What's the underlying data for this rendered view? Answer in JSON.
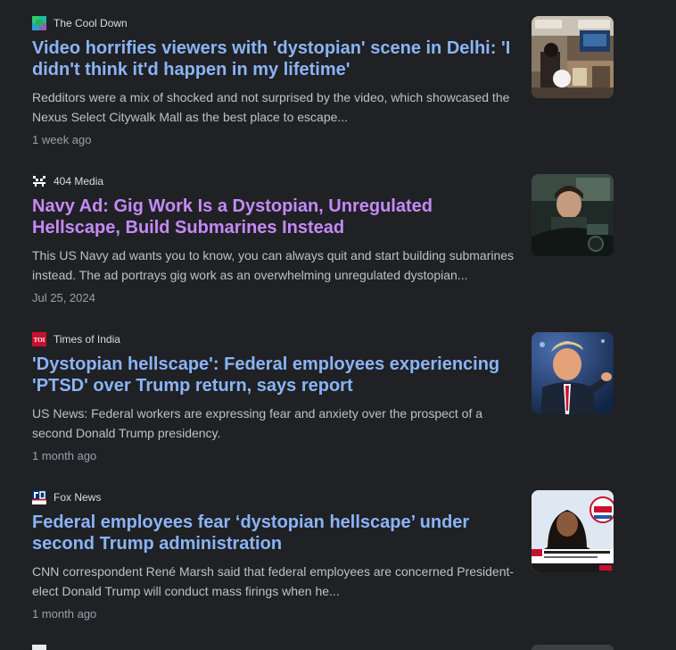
{
  "articles": [
    {
      "source": "The Cool Down",
      "title": "Video horrifies viewers with 'dystopian' scene in Delhi: 'I didn't think it'd happen in my lifetime'",
      "snippet": "Redditors were a mix of shocked and not surprised by the video, which showcased the Nexus Select Citywalk Mall as the best place to escape...",
      "time": "1 week ago",
      "visited": false,
      "favicon_icon": "the-cool-down-logo-icon",
      "thumb_icon": "mall-interior-photo"
    },
    {
      "source": "404 Media",
      "title": "Navy Ad: Gig Work Is a Dystopian, Unregulated Hellscape, Build Submarines Instead",
      "snippet": "This US Navy ad wants you to know, you can always quit and start building submarines instead. The ad portrays gig work as an overwhelming unregulated dystopian...",
      "time": "Jul 25, 2024",
      "visited": true,
      "favicon_icon": "404-media-logo-icon",
      "thumb_icon": "driver-in-car-photo"
    },
    {
      "source": "Times of India",
      "title": "'Dystopian hellscape': Federal employees experiencing 'PTSD' over Trump return, says report",
      "snippet": "US News: Federal workers are expressing fear and anxiety over the prospect of a second Donald Trump presidency.",
      "time": "1 month ago",
      "visited": false,
      "favicon_icon": "toi-logo-icon",
      "favicon_text": "TOI",
      "thumb_icon": "trump-pointing-photo"
    },
    {
      "source": "Fox News",
      "title": "Federal employees fear ‘dystopian hellscape’ under second Trump administration",
      "snippet": "CNN correspondent René Marsh said that federal employees are concerned President-elect Donald Trump will conduct mass firings when he...",
      "time": "1 month ago",
      "visited": false,
      "favicon_icon": "fox-news-logo-icon",
      "thumb_icon": "cnn-news-anchor-photo"
    }
  ],
  "colors": {
    "background": "#202124",
    "link": "#8ab4f8",
    "visited_link": "#c58af9",
    "snippet": "#bdc1c6",
    "meta": "#9aa0a6",
    "source": "#dadce0"
  }
}
